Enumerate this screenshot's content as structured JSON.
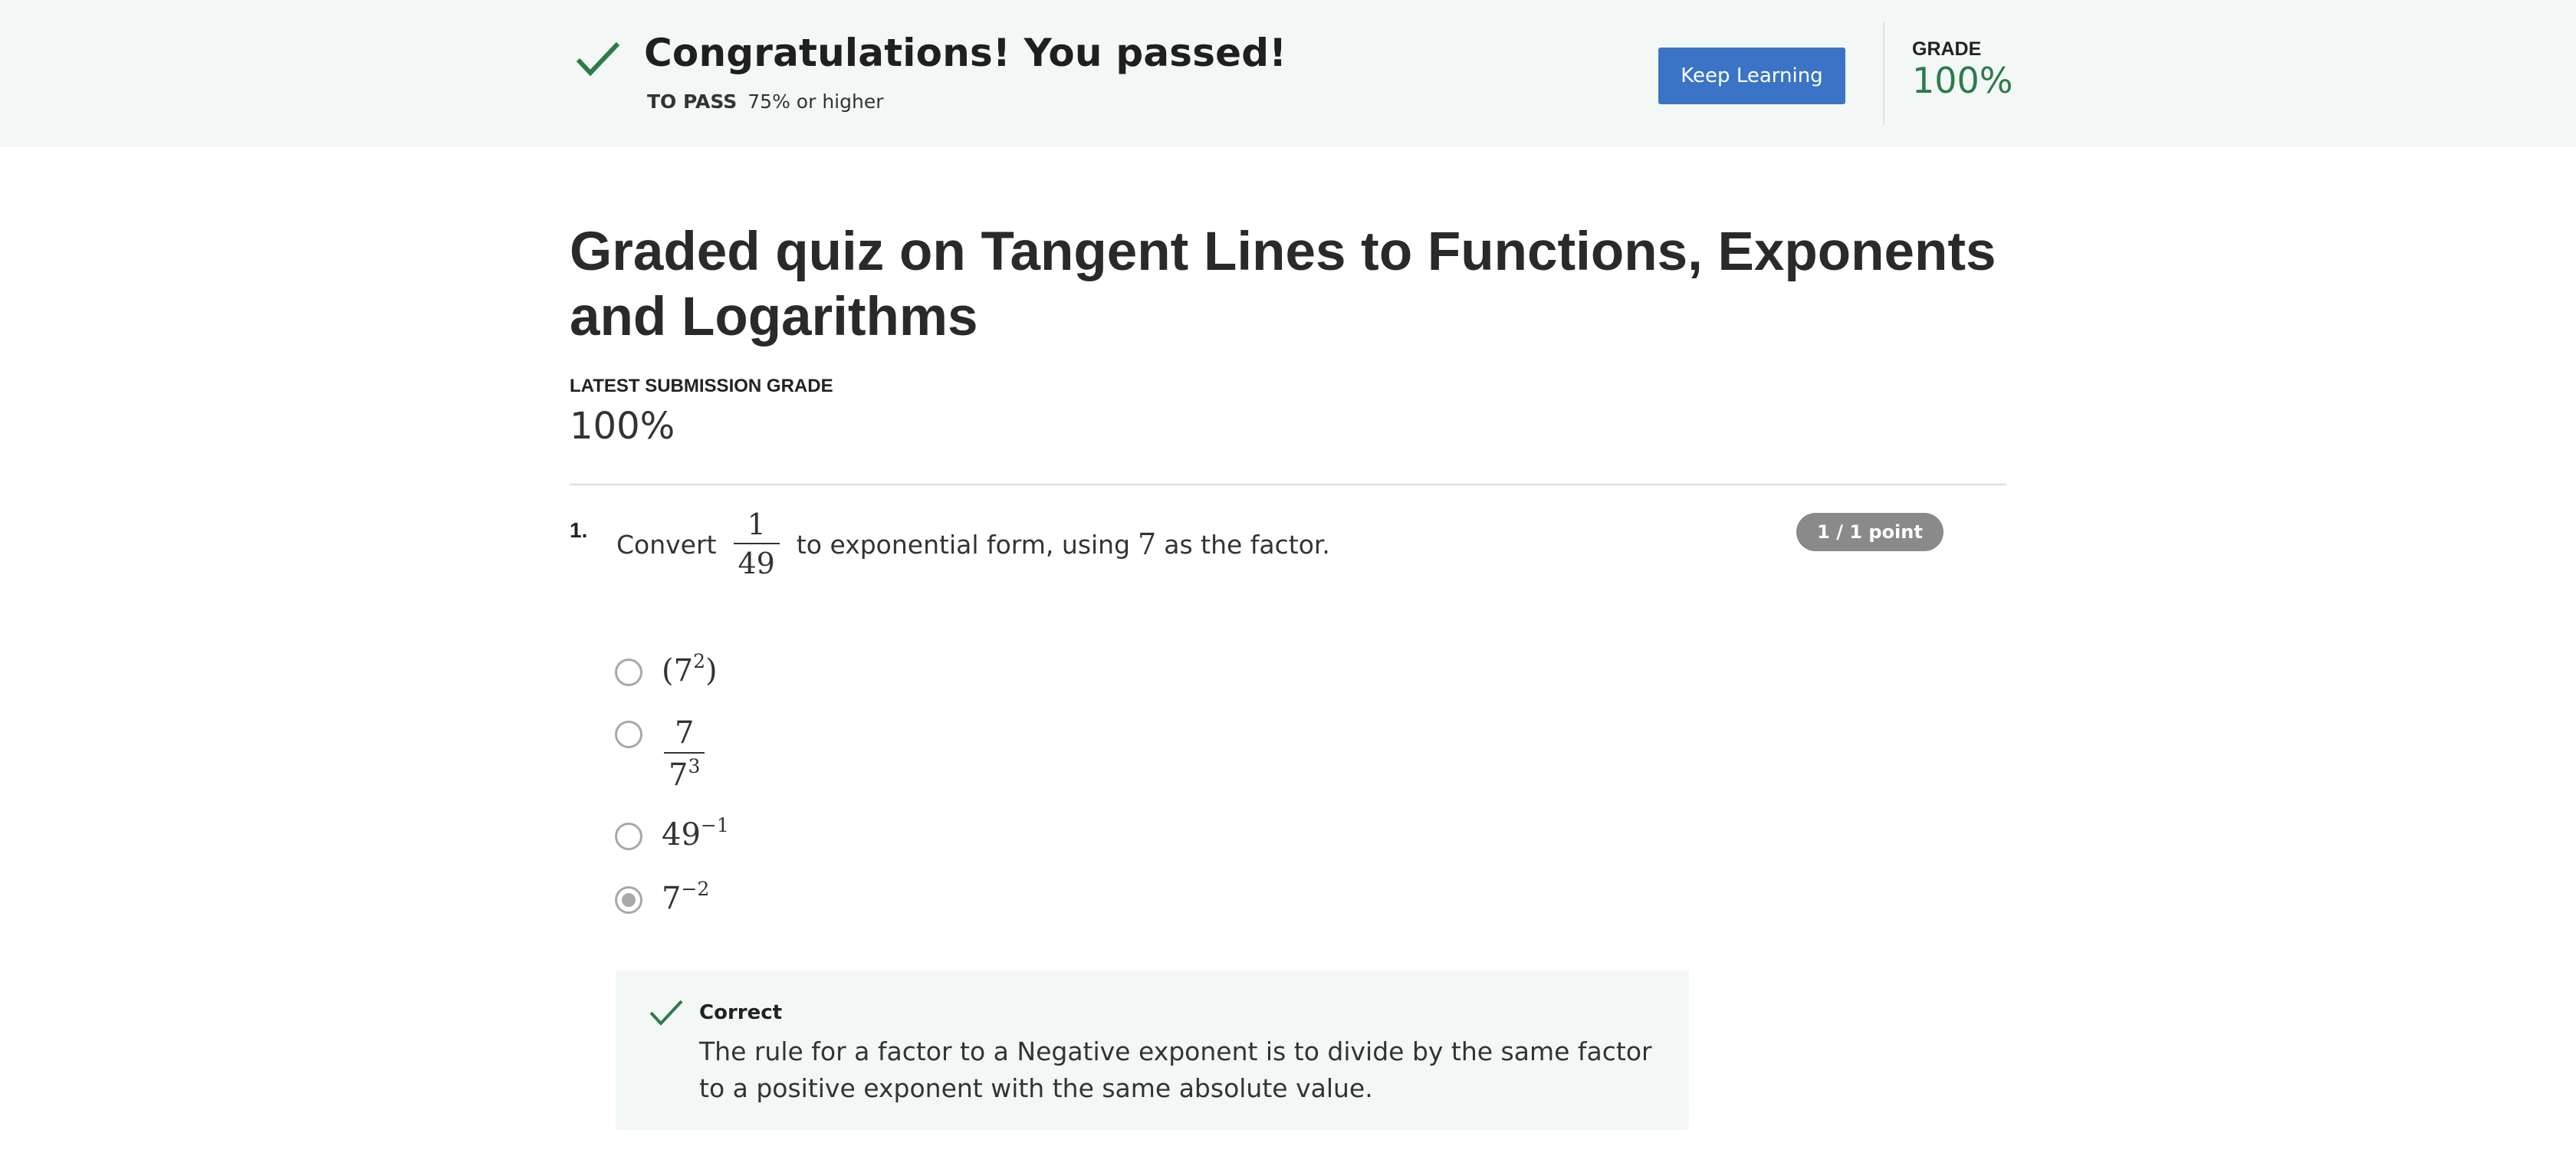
{
  "banner": {
    "title": "Congratulations! You passed!",
    "to_pass_label": "TO PASS",
    "to_pass_value": "75% or higher",
    "keep_learning_label": "Keep Learning",
    "grade_label": "GRADE",
    "grade_value": "100%",
    "check_icon": "check-icon"
  },
  "quiz": {
    "title": "Graded quiz on Tangent Lines to Functions, Exponents and Logarithms",
    "latest_label": "LATEST SUBMISSION GRADE",
    "latest_value": "100%"
  },
  "question": {
    "number": "1.",
    "text_before": "Convert",
    "fraction_numerator": "1",
    "fraction_denominator": "49",
    "text_middle": "to exponential form, using",
    "factor": "7",
    "text_after": "as the factor.",
    "points": "1 / 1 point",
    "options": [
      {
        "base": "(7",
        "exp": "2",
        "close": ")",
        "selected": false
      },
      {
        "numerator": "7",
        "den_base": "7",
        "den_exp": "3",
        "selected": false
      },
      {
        "base": "49",
        "exp": "−1",
        "selected": false
      },
      {
        "base": "7",
        "exp": "−2",
        "selected": true
      }
    ]
  },
  "feedback": {
    "label": "Correct",
    "text": "The rule for a factor to a Negative exponent is to divide by the same factor to a positive exponent with the same absolute value.",
    "check_icon": "check-icon"
  },
  "colors": {
    "banner_bg": "#f3f8f6",
    "success_green": "#2c7b4b",
    "button_blue": "#3b74c6",
    "points_badge": "#8a8a8a"
  }
}
